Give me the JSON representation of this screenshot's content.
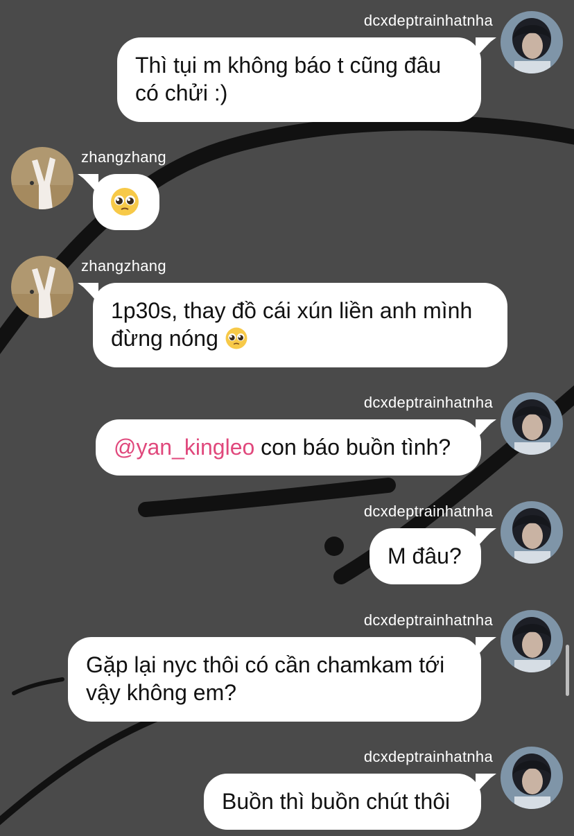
{
  "messages": [
    {
      "sender": "dcxdeptrainhatnha",
      "text": "Thì tụi m không báo t cũng đâu có chửi :)"
    },
    {
      "sender": "zhangzhang",
      "text": "🥹"
    },
    {
      "sender": "zhangzhang",
      "text": "1p30s, thay đồ cái xún liền anh mình đừng nóng",
      "emoji": "🥹"
    },
    {
      "sender": "dcxdeptrainhatnha",
      "mention": "@yan_kingleo",
      "text": " con báo buồn tình?"
    },
    {
      "sender": "dcxdeptrainhatnha",
      "text": "M đâu?"
    },
    {
      "sender": "dcxdeptrainhatnha",
      "text": "Gặp lại nyc thôi có cần chamkam tới vậy không em?"
    },
    {
      "sender": "dcxdeptrainhatnha",
      "text": "Buồn thì buồn chút thôi"
    }
  ],
  "colors": {
    "background": "#4a4a4a",
    "bubble": "#ffffff",
    "mention": "#e0487c",
    "stroke": "#111111"
  },
  "icons": {
    "outgoing_avatar": "avatar-photo-dark-hair",
    "incoming_avatar": "avatar-photo-peace-sign",
    "emoji": "pleading-face-emoji"
  }
}
